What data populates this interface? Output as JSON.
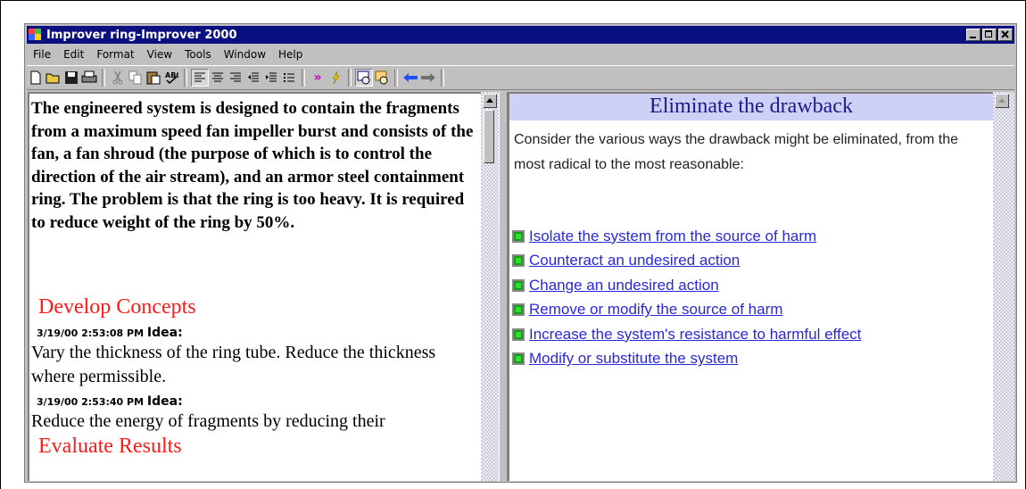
{
  "window": {
    "title": "Improver ring-Improver 2000"
  },
  "menu": [
    "File",
    "Edit",
    "Format",
    "View",
    "Tools",
    "Window",
    "Help"
  ],
  "toolbar": {
    "icons": [
      "new-document-icon",
      "open-folder-icon",
      "save-icon",
      "print-icon",
      "cut-icon",
      "copy-icon",
      "paste-icon",
      "spellcheck-icon",
      "align-left-icon",
      "align-center-icon",
      "align-right-icon",
      "outdent-icon",
      "indent-icon",
      "bullets-icon",
      "forward-icon",
      "lightning-icon",
      "view-left-icon",
      "view-right-icon",
      "back-arrow-icon",
      "forward-arrow-icon"
    ]
  },
  "left_pane": {
    "problem_text": "The engineered system is designed to contain the fragments from a maximum speed fan impeller burst and consists of the fan, a fan shroud (the purpose of which is to control the direction of the air stream), and an armor steel containment ring. The problem is that the ring is too heavy.  It is required to reduce weight of the ring by 50%.",
    "develop_heading": "Develop Concepts",
    "entries": [
      {
        "timestamp": "3/19/00 2:53:08 PM",
        "label": "Idea:",
        "text": "Vary the thickness of the ring tube.  Reduce the thickness where permissible."
      },
      {
        "timestamp": "3/19/00 2:53:40 PM",
        "label": "Idea:",
        "text": "Reduce the energy of fragments by reducing their"
      }
    ],
    "evaluate_heading": "Evaluate Results"
  },
  "right_pane": {
    "title": "Eliminate the drawback",
    "intro": "Consider the various ways the drawback might be eliminated, from the most radical to the most reasonable:",
    "links": [
      " Isolate the system from the source of harm",
      "Counteract an undesired action",
      "Change an undesired action",
      "Remove or modify the source of harm",
      " Increase the system's resistance to harmful effect",
      "Modify or substitute the system"
    ]
  },
  "colors": {
    "titlebar": "#0a1080",
    "heading_red": "#ff1a1a",
    "right_header_bg": "#cfd0f6",
    "link_blue": "#2828d8"
  }
}
